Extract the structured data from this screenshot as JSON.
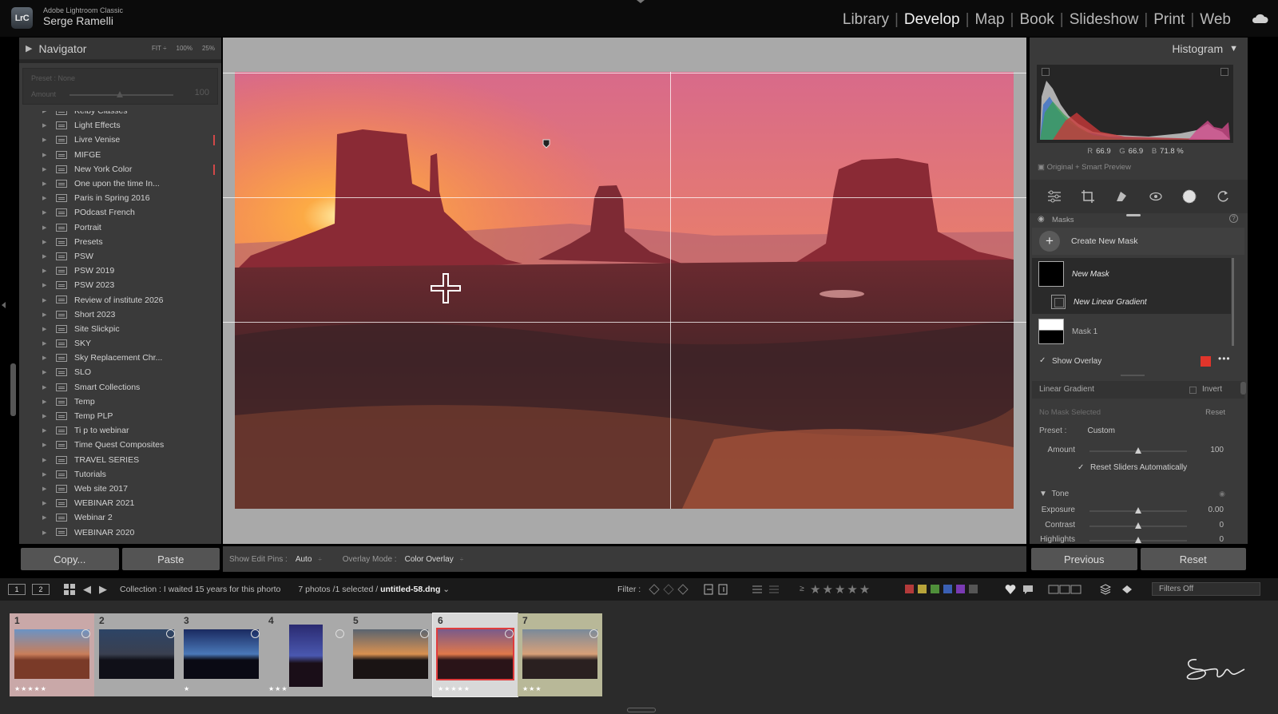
{
  "app": {
    "logo_text": "LrC",
    "product_name": "Adobe Lightroom Classic",
    "user_name": "Serge Ramelli",
    "modules": [
      {
        "label": "Library",
        "active": false
      },
      {
        "label": "Develop",
        "active": true
      },
      {
        "label": "Map",
        "active": false
      },
      {
        "label": "Book",
        "active": false
      },
      {
        "label": "Slideshow",
        "active": false
      },
      {
        "label": "Print",
        "active": false
      },
      {
        "label": "Web",
        "active": false
      }
    ],
    "cloud_icon": "cloud-sync-icon"
  },
  "left_panel": {
    "navigator_title": "Navigator",
    "zoom_levels": [
      "FIT ÷",
      "100%",
      "25%"
    ],
    "preset_label": "Preset : None",
    "amount_label": "Amount",
    "amount_value": "100",
    "collections": [
      {
        "label": "Kelby Classes",
        "marked": false
      },
      {
        "label": "Light Effects",
        "marked": false
      },
      {
        "label": "Livre Venise",
        "marked": true
      },
      {
        "label": "MIFGE",
        "marked": false
      },
      {
        "label": "New York Color",
        "marked": true
      },
      {
        "label": "One upon the time In...",
        "marked": false
      },
      {
        "label": "Paris in Spring 2016",
        "marked": false
      },
      {
        "label": "POdcast French",
        "marked": false
      },
      {
        "label": "Portrait",
        "marked": false
      },
      {
        "label": "Presets",
        "marked": false
      },
      {
        "label": "PSW",
        "marked": false
      },
      {
        "label": "PSW 2019",
        "marked": false
      },
      {
        "label": "PSW 2023",
        "marked": false
      },
      {
        "label": "Review of institute 2026",
        "marked": false
      },
      {
        "label": "Short 2023",
        "marked": false
      },
      {
        "label": "Site Slickpic",
        "marked": false
      },
      {
        "label": "SKY",
        "marked": false
      },
      {
        "label": "Sky Replacement Chr...",
        "marked": false
      },
      {
        "label": "SLO",
        "marked": false
      },
      {
        "label": "Smart Collections",
        "marked": false
      },
      {
        "label": "Temp",
        "marked": false
      },
      {
        "label": "Temp PLP",
        "marked": false
      },
      {
        "label": "Ti p to webinar",
        "marked": false
      },
      {
        "label": "Time Quest Composites",
        "marked": false
      },
      {
        "label": "TRAVEL SERIES",
        "marked": false
      },
      {
        "label": "Tutorials",
        "marked": false
      },
      {
        "label": "Web site 2017",
        "marked": false
      },
      {
        "label": "WEBINAR  2021",
        "marked": false
      },
      {
        "label": "Webinar 2",
        "marked": false
      },
      {
        "label": "WEBINAR 2020",
        "marked": false
      }
    ],
    "copy_label": "Copy...",
    "paste_label": "Paste"
  },
  "toolbar": {
    "edit_pins_label": "Show Edit Pins :",
    "edit_pins_value": "Auto",
    "overlay_mode_label": "Overlay Mode :",
    "overlay_mode_value": "Color Overlay"
  },
  "right_panel": {
    "histogram_title": "Histogram",
    "rgb": {
      "r_label": "R",
      "r": "66.9",
      "g_label": "G",
      "g": "66.9",
      "b_label": "B",
      "b": "71.8 %"
    },
    "preview_label": "Original + Smart Preview",
    "tools": [
      "edit-sliders-icon",
      "crop-icon",
      "healing-icon",
      "red-eye-icon",
      "masking-icon",
      "reset-icon"
    ],
    "masks_title": "Masks",
    "create_mask_label": "Create New Mask",
    "mask_new_label": "New Mask",
    "mask_linear_label": "New Linear Gradient",
    "mask1_label": "Mask 1",
    "show_overlay_label": "Show Overlay",
    "overlay_color": "#e0352b",
    "linear_gradient_title": "Linear Gradient",
    "invert_label": "Invert",
    "no_mask_label": "No Mask Selected",
    "reset_label": "Reset",
    "preset_label": "Preset :",
    "preset_value": "Custom",
    "amount_label": "Amount",
    "amount_value": "100",
    "reset_sliders_label": "Reset Sliders Automatically",
    "tone_title": "Tone",
    "sliders": [
      {
        "label": "Exposure",
        "value": "0.00"
      },
      {
        "label": "Contrast",
        "value": "0"
      },
      {
        "label": "Highlights",
        "value": "0"
      }
    ],
    "previous_label": "Previous",
    "reset_button_label": "Reset"
  },
  "filmstrip_bar": {
    "screen1": "1",
    "screen2": "2",
    "collection_text": "Collection : I waited 15 years for this phorto",
    "count_text": "7 photos /1 selected /",
    "filename": "untitled-58.dng",
    "filter_label": "Filter :",
    "rating_op": "≥",
    "stars": "★★★★★",
    "color_labels": [
      "#b33a3a",
      "#b8a43a",
      "#4f8f3a",
      "#3a5fb3",
      "#7a3ab3",
      "#555555"
    ],
    "filters_off_label": "Filters Off"
  },
  "filmstrip": [
    {
      "num": "1",
      "stars": "★★★★★",
      "selected": false,
      "bg": "#c9a8a8"
    },
    {
      "num": "2",
      "stars": "",
      "selected": false,
      "bg": "#a9a9a9"
    },
    {
      "num": "3",
      "stars": "★",
      "selected": false,
      "bg": "#a9a9a9"
    },
    {
      "num": "4",
      "stars": "★★★",
      "selected": false,
      "bg": "#a9a9a9"
    },
    {
      "num": "5",
      "stars": "",
      "selected": false,
      "bg": "#a9a9a9"
    },
    {
      "num": "6",
      "stars": "★★★★★",
      "selected": true,
      "bg": "#d8d8d8"
    },
    {
      "num": "7",
      "stars": "★★★",
      "selected": false,
      "bg": "#b8b898"
    }
  ]
}
